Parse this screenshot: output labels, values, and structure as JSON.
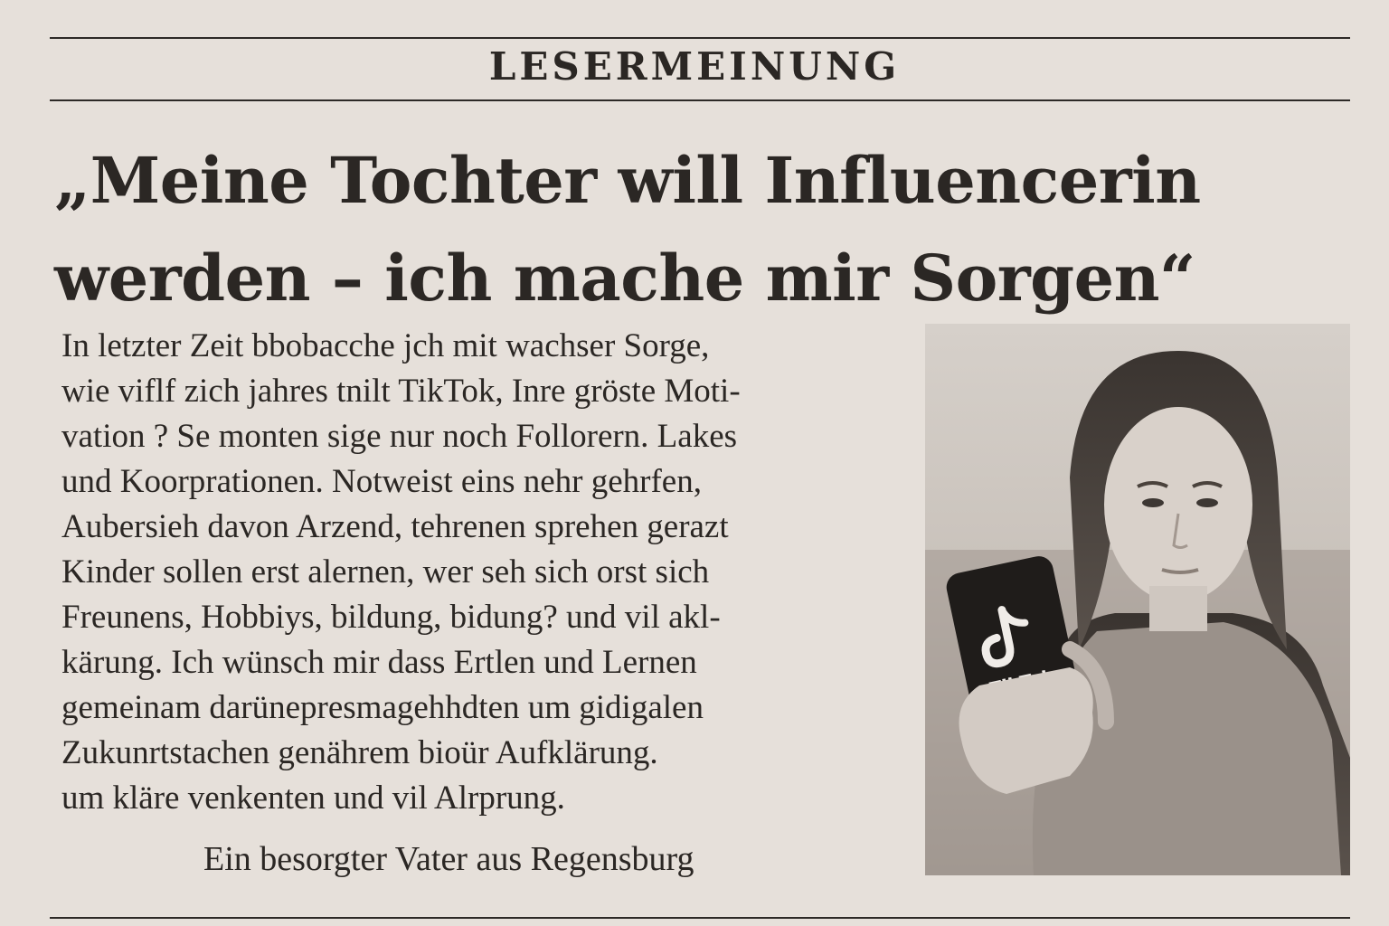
{
  "section": {
    "label": "LESERMEINUNG"
  },
  "headline": {
    "lines": [
      "„Meine Tochter will Influencerin",
      "werden – ich mache mir Sorgen“"
    ]
  },
  "body": {
    "lines": [
      "In letzter Zeit bbobacche jch mit wachser Sorge,",
      "wie viflf zich jahres tnilt TikTok, Inre gröste Moti-",
      "vation ?  Se monten sige nur noch Follorern. Lakes",
      "und Koorprationen. Notweist eins nehr gehrfen,",
      "Aubersieh davon Arzend, tehrenen sprehen gerazt",
      "Kinder  sollen erst alernen, wer seh sich orst sich",
      "Freunens, Hobbiys, bildung,  bidung? und vil akl-",
      "kärung. Ich wünsch mir dass  Ertlen und Lernen",
      "gemeinam darünepresmagehhdten um gidigalen",
      "Zukunrtstachen genährem bioür Aufklärung.",
      "um kläre venkenten und vil Alrprung."
    ]
  },
  "signature": "Ein besorgter Vater aus Regensburg",
  "photo": {
    "phone_brand_text": "TikTok",
    "icon": "tiktok-logo-icon"
  },
  "colors": {
    "paper": "#e6e0da",
    "ink": "#2b2724",
    "rule": "#2d2926"
  }
}
